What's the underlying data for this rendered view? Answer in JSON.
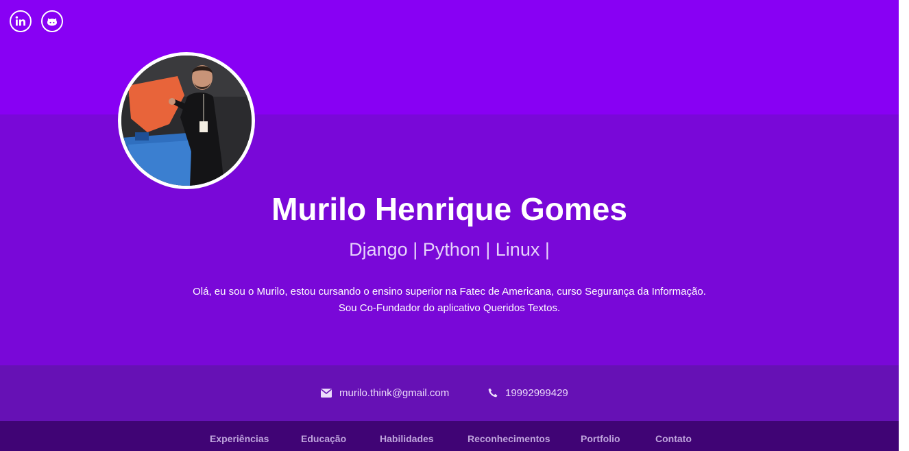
{
  "social": {
    "linkedin_icon": "linkedin-icon",
    "github_icon": "github-icon"
  },
  "profile": {
    "name": "Murilo Henrique Gomes",
    "tagline": "Django | Python | Linux |",
    "bio_line1": "Olá, eu sou o Murilo, estou cursando o ensino superior na Fatec de Americana, curso Segurança da Informação.",
    "bio_line2": "Sou Co-Fundador do aplicativo Queridos Textos."
  },
  "contact": {
    "email": "murilo.think@gmail.com",
    "phone": "19992999429",
    "email_icon": "envelope-icon",
    "phone_icon": "phone-icon"
  },
  "nav": {
    "items": [
      {
        "label": "Experiências"
      },
      {
        "label": "Educação"
      },
      {
        "label": "Habilidades"
      },
      {
        "label": "Reconhecimentos"
      },
      {
        "label": "Portfolio"
      },
      {
        "label": "Contato"
      }
    ]
  },
  "colors": {
    "top_band": "#8800f4",
    "main_band": "#7908d8",
    "contact_band": "#6611b5",
    "nav_band": "#400475"
  }
}
